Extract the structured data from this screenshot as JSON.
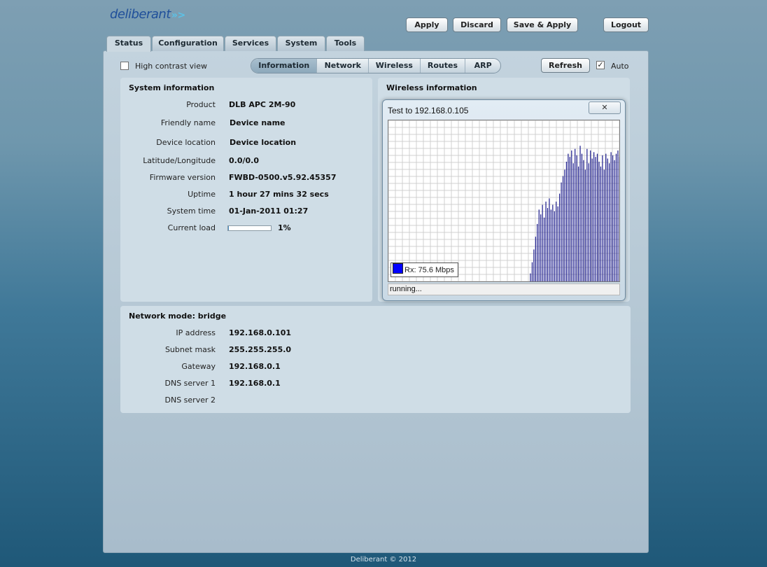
{
  "brand": {
    "logo_text": "deliberant",
    "logo_chevrons": "»>"
  },
  "top_buttons": {
    "apply": "Apply",
    "discard": "Discard",
    "save_apply": "Save & Apply",
    "logout": "Logout"
  },
  "main_tabs": [
    {
      "label": "Status",
      "active": true
    },
    {
      "label": "Configuration",
      "active": false
    },
    {
      "label": "Services",
      "active": false
    },
    {
      "label": "System",
      "active": false
    },
    {
      "label": "Tools",
      "active": false
    }
  ],
  "high_contrast": {
    "label": "High contrast view",
    "checked": false
  },
  "sub_tabs": [
    {
      "label": "Information",
      "active": true
    },
    {
      "label": "Network",
      "active": false
    },
    {
      "label": "Wireless",
      "active": false
    },
    {
      "label": "Routes",
      "active": false
    },
    {
      "label": "ARP",
      "active": false
    }
  ],
  "refresh": {
    "label": "Refresh",
    "auto_label": "Auto",
    "auto_checked": true
  },
  "system_info": {
    "title": "System information",
    "rows": [
      {
        "label": "Product",
        "value": "DLB APC 2M-90"
      },
      {
        "label": "Friendly name",
        "value": "Device name"
      },
      {
        "label": "Device location",
        "value": "Device location"
      },
      {
        "label": "Latitude/Longitude",
        "value": "0.0/0.0"
      },
      {
        "label": "Firmware version",
        "value": "FWBD-0500.v5.92.45357"
      },
      {
        "label": "Uptime",
        "value": "1 hour 27 mins 32 secs"
      },
      {
        "label": "System time",
        "value": "01-Jan-2011 01:27"
      }
    ],
    "current_load": {
      "label": "Current load",
      "value": "1%",
      "fraction": 0.01
    }
  },
  "wireless_info": {
    "title": "Wireless information"
  },
  "network": {
    "title": "Network mode: bridge",
    "rows": [
      {
        "label": "IP address",
        "value": "192.168.0.101"
      },
      {
        "label": "Subnet mask",
        "value": "255.255.255.0"
      },
      {
        "label": "Gateway",
        "value": "192.168.0.1"
      },
      {
        "label": "DNS server 1",
        "value": "192.168.0.1"
      },
      {
        "label": "DNS server 2",
        "value": ""
      }
    ]
  },
  "popup": {
    "title": "Test to 192.168.0.105",
    "close_glyph": "✕",
    "legend": "Rx: 75.6 Mbps",
    "status": "running...",
    "series_color": "#1a1a8c",
    "legend_color": "#0000ff",
    "rx_fractions": [
      0.05,
      0.12,
      0.2,
      0.28,
      0.36,
      0.45,
      0.42,
      0.48,
      0.4,
      0.5,
      0.46,
      0.52,
      0.45,
      0.48,
      0.44,
      0.5,
      0.47,
      0.55,
      0.62,
      0.66,
      0.7,
      0.75,
      0.8,
      0.78,
      0.82,
      0.74,
      0.83,
      0.79,
      0.72,
      0.85,
      0.8,
      0.76,
      0.7,
      0.83,
      0.74,
      0.82,
      0.77,
      0.81,
      0.78,
      0.8,
      0.75,
      0.72,
      0.79,
      0.7,
      0.8,
      0.77,
      0.74,
      0.81,
      0.79,
      0.76,
      0.8,
      0.82,
      0.78
    ]
  },
  "footer": "Deliberant © 2012"
}
